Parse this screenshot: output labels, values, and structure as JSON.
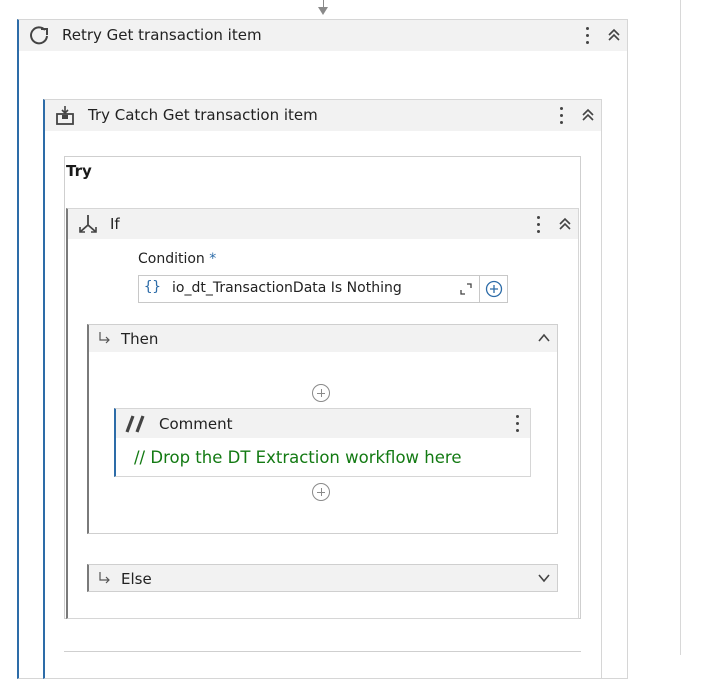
{
  "retry_scope": {
    "title": "Retry Get transaction item"
  },
  "try_catch": {
    "title": "Try Catch Get transaction item",
    "try_label": "Try"
  },
  "if_activity": {
    "title": "If",
    "condition_label": "Condition",
    "required_marker": "*",
    "condition_braces": "{}",
    "condition_value": "io_dt_TransactionData Is Nothing"
  },
  "then_branch": {
    "label": "Then"
  },
  "comment": {
    "title": "Comment",
    "text": "// Drop the DT Extraction workflow here"
  },
  "else_branch": {
    "label": "Else"
  },
  "colors": {
    "accent": "#2d6ca8",
    "comment_text": "#137a13",
    "header_bg": "#f2f2f2"
  }
}
